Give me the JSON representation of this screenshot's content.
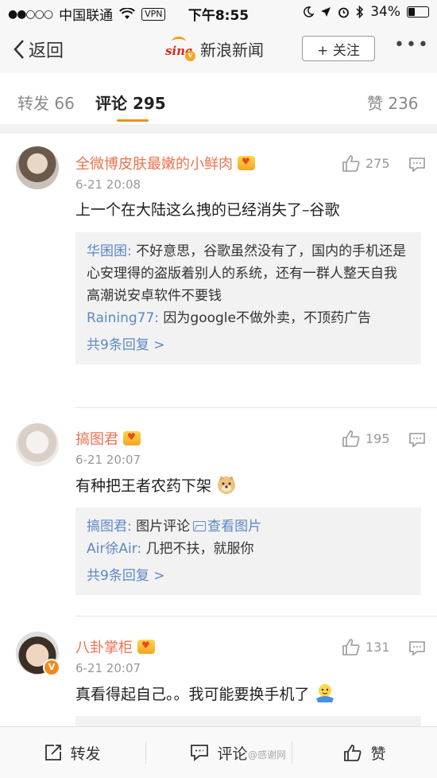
{
  "status_bar": {
    "signal": "●●○○○",
    "carrier": "中国联通",
    "vpn": "VPN",
    "time": "下午8:55",
    "battery": "34%"
  },
  "nav": {
    "back_label": "返回",
    "title": "新浪新闻",
    "follow_label": "+ 关注",
    "more_label": "•••"
  },
  "tabs": {
    "repost": "转发 66",
    "comments": "评论 295",
    "likes": "赞 236"
  },
  "comments": [
    {
      "username": "全微博皮肤最嫩的小鲜肉",
      "time": "6-21 20:08",
      "text": "上一个在大陆这么拽的已经消失了–谷歌",
      "likes": "275",
      "replies": [
        {
          "name": "华囷囷:",
          "text": " 不好意思，谷歌虽然没有了，国内的手机还是心安理得的盗版着别人的系统，还有一群人整天自我高潮说安卓软件不要钱"
        },
        {
          "name": "Raining77:",
          "text": " 因为google不做外卖，不顶药广告"
        }
      ],
      "more_replies": "共9条回复 >"
    },
    {
      "username": "搞图君",
      "time": "6-21 20:07",
      "text": "有种把王者农药下架",
      "likes": "195",
      "replies": [
        {
          "name": "搞图君:",
          "text": " 图片评论",
          "link": "查看图片"
        },
        {
          "name": "Air徐Air:",
          "text": " 几把不扶，就服你"
        }
      ],
      "more_replies": "共9条回复 >"
    },
    {
      "username": "八卦掌柜",
      "time": "6-21 20:07",
      "text": "真看得起自己。。我可能要换手机了",
      "likes": "131",
      "avatar_badge": "V"
    }
  ],
  "bottom_bar": {
    "repost": "转发",
    "comment": "评论",
    "like": "赞"
  },
  "watermark": "@感谢网",
  "colors": {
    "accent_orange": "#f18f1b",
    "username": "#eb7350",
    "reply_name": "#5d88c5"
  }
}
